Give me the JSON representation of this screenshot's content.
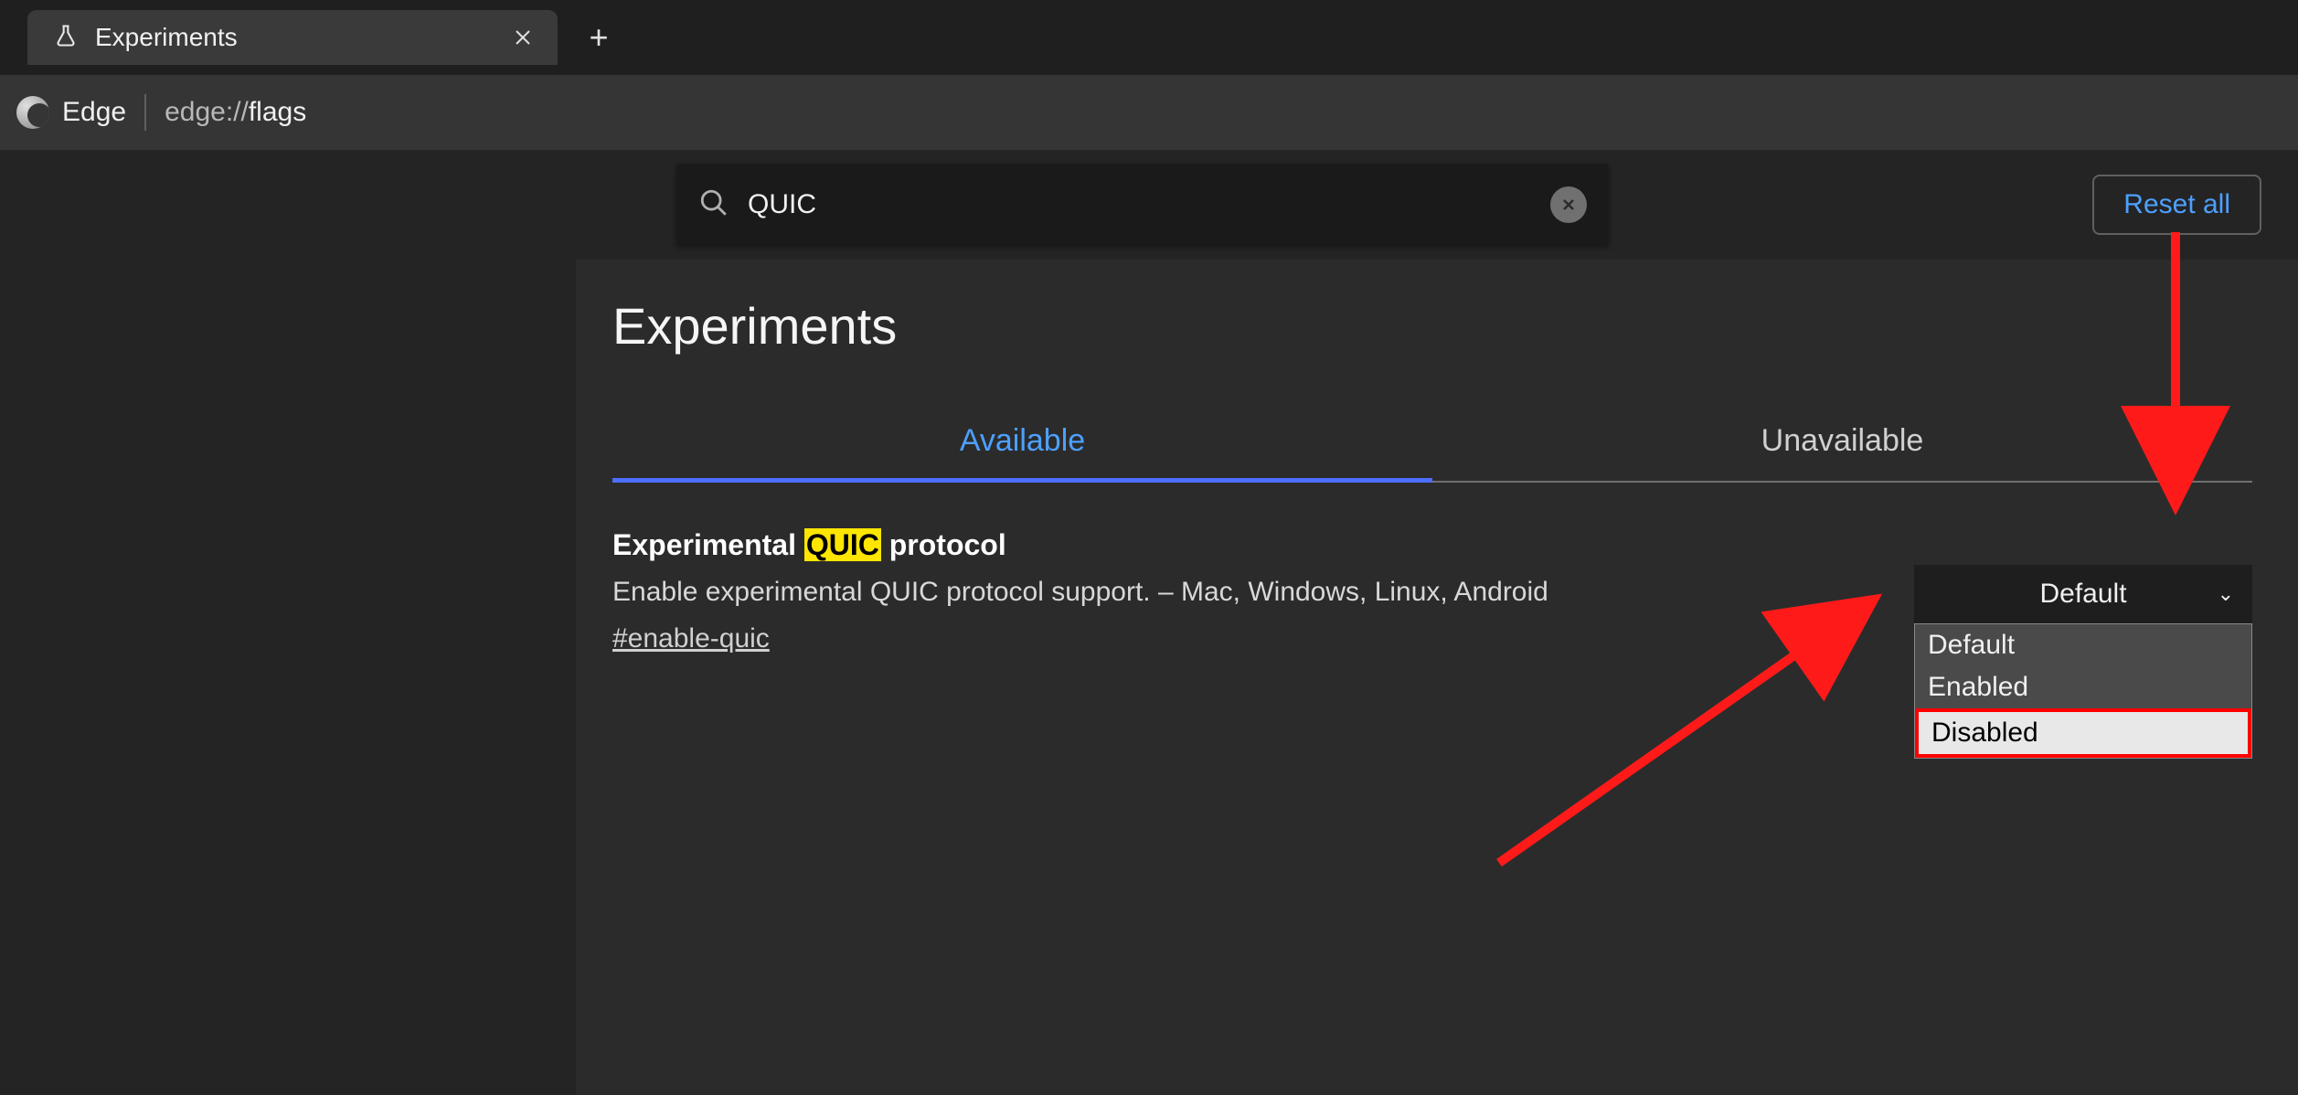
{
  "tab": {
    "title": "Experiments"
  },
  "addressBar": {
    "app": "Edge",
    "url_prefix": "edge://",
    "url_bold": "flags"
  },
  "search": {
    "value": "QUIC"
  },
  "toolbar": {
    "reset": "Reset all"
  },
  "page": {
    "title": "Experiments"
  },
  "tabs": {
    "available": "Available",
    "unavailable": "Unavailable"
  },
  "experiment": {
    "title_pre": "Experimental ",
    "title_hl": "QUIC",
    "title_post": " protocol",
    "description": "Enable experimental QUIC protocol support. – Mac, Windows, Linux, Android",
    "anchor": "#enable-quic",
    "selected": "Default",
    "options": {
      "default": "Default",
      "enabled": "Enabled",
      "disabled": "Disabled"
    }
  }
}
